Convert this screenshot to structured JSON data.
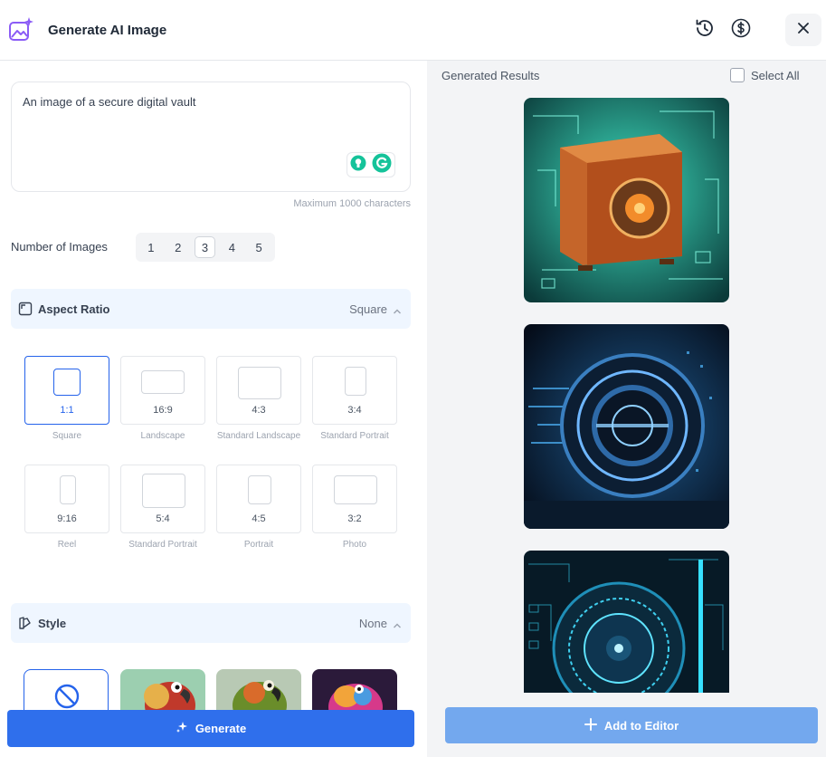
{
  "header": {
    "title": "Generate AI Image",
    "icons": [
      "image-sparkle-icon",
      "history-icon",
      "dollar-icon",
      "close-icon"
    ]
  },
  "prompt": {
    "value": "An image of a secure digital vault",
    "max_chars_hint": "Maximum 1000 characters"
  },
  "num_images": {
    "label": "Number of Images",
    "options": [
      "1",
      "2",
      "3",
      "4",
      "5"
    ],
    "selected": "3"
  },
  "aspect_ratio": {
    "title": "Aspect Ratio",
    "value": "Square",
    "options": [
      {
        "ratio": "1:1",
        "name": "Square"
      },
      {
        "ratio": "16:9",
        "name": "Landscape"
      },
      {
        "ratio": "4:3",
        "name": "Standard Landscape"
      },
      {
        "ratio": "3:4",
        "name": "Standard Portrait"
      },
      {
        "ratio": "9:16",
        "name": "Reel"
      },
      {
        "ratio": "5:4",
        "name": "Standard Portrait"
      },
      {
        "ratio": "4:5",
        "name": "Portrait"
      },
      {
        "ratio": "3:2",
        "name": "Photo"
      }
    ],
    "selected": "1:1"
  },
  "style": {
    "title": "Style",
    "value": "None"
  },
  "generate_label": "Generate",
  "results": {
    "label": "Generated Results",
    "select_all": "Select All",
    "add_to_editor": "Add to Editor"
  },
  "colors": {
    "primary": "#2f6fec",
    "primary_disabled": "#73a8ee",
    "section_bg": "#eff6ff",
    "panel_bg": "#f3f4f6",
    "brand_purple": "#8b5cf6"
  }
}
